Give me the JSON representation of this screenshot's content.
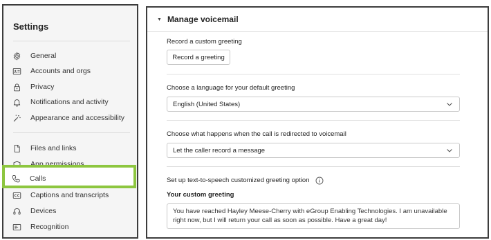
{
  "sidebar": {
    "title": "Settings",
    "items": [
      {
        "label": "General",
        "icon": "gear-icon"
      },
      {
        "label": "Accounts and orgs",
        "icon": "id-card-icon"
      },
      {
        "label": "Privacy",
        "icon": "lock-icon"
      },
      {
        "label": "Notifications and activity",
        "icon": "bell-icon"
      },
      {
        "label": "Appearance and accessibility",
        "icon": "magic-wand-icon"
      },
      {
        "label": "Files and links",
        "icon": "file-icon"
      },
      {
        "label": "App permissions",
        "icon": "shield-icon"
      },
      {
        "label": "Calls",
        "icon": "phone-icon"
      },
      {
        "label": "Captions and transcripts",
        "icon": "closed-caption-icon"
      },
      {
        "label": "Devices",
        "icon": "headset-icon"
      },
      {
        "label": "Recognition",
        "icon": "recognition-icon"
      }
    ],
    "highlight_color": "#8dc63f"
  },
  "voicemail": {
    "section_title": "Manage voicemail",
    "record_label": "Record a custom greeting",
    "record_button": "Record a greeting",
    "language_label": "Choose a language for your default greeting",
    "language_value": "English (United States)",
    "redirect_label": "Choose what happens when the call is redirected to voicemail",
    "redirect_value": "Let the caller record a message",
    "tts_label": "Set up text-to-speech customized greeting option",
    "custom_greeting_label": "Your custom greeting",
    "custom_greeting_text": "You have reached Hayley Meese-Cherry with eGroup Enabling Technologies. I am unavailable right now, but I will return your call as soon as possible. Have a great day!"
  }
}
